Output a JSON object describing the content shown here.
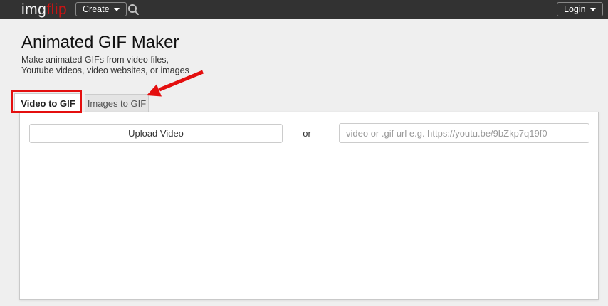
{
  "navbar": {
    "logo": {
      "part1": "img",
      "part2": "flip"
    },
    "create_button": {
      "label": "Create"
    },
    "login_button": {
      "label": "Login"
    }
  },
  "page": {
    "title": "Animated GIF Maker",
    "subtitle": "Make animated GIFs from video files, Youtube videos, video websites, or images"
  },
  "tabs": [
    {
      "label": "Video to GIF",
      "active": true
    },
    {
      "label": "Images to GIF",
      "active": false
    }
  ],
  "gif_maker": {
    "upload_button_label": "Upload Video",
    "or_label": "or",
    "url_input": {
      "value": "",
      "placeholder": "video or .gif url e.g. https://youtu.be/9bZkp7q19f0"
    }
  },
  "annotations": {
    "highlight_color": "#e40f0f",
    "highlighted_tab": "Video to GIF",
    "arrow_points_to": "Images to GIF"
  },
  "colors": {
    "navbar_bg": "#323232",
    "logo_img": "#f2f2f2",
    "logo_flip": "#c81414",
    "page_bg": "#efefef",
    "panel_bg": "#ffffff",
    "border": "#cccccc"
  }
}
